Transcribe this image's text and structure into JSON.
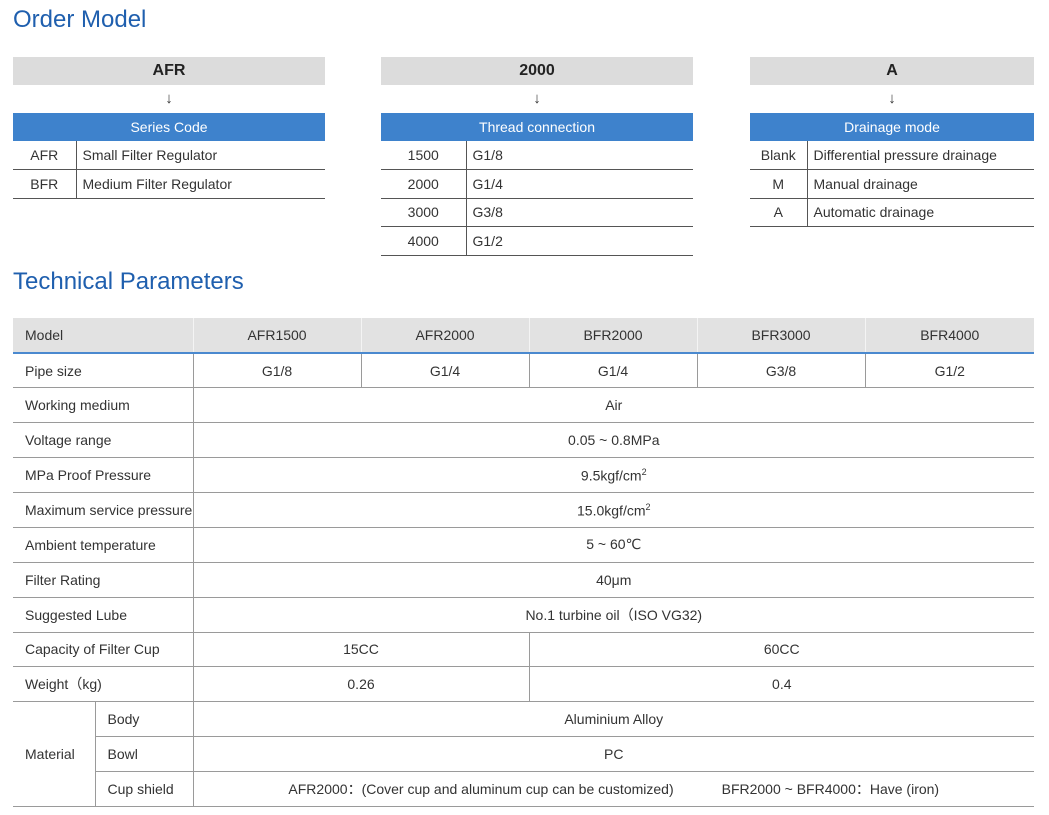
{
  "order_model": {
    "title": "Order Model",
    "arrow": "↓",
    "blocks": [
      {
        "code": "AFR",
        "heading": "Series Code",
        "rows": [
          {
            "code": "AFR",
            "desc": "Small Filter Regulator"
          },
          {
            "code": "BFR",
            "desc": "Medium Filter Regulator"
          }
        ]
      },
      {
        "code": "2000",
        "heading": "Thread connection",
        "rows": [
          {
            "code": "1500",
            "desc": "G1/8"
          },
          {
            "code": "2000",
            "desc": "G1/4"
          },
          {
            "code": "3000",
            "desc": "G3/8"
          },
          {
            "code": "4000",
            "desc": "G1/2"
          }
        ]
      },
      {
        "code": "A",
        "heading": "Drainage mode",
        "rows": [
          {
            "code": "Blank",
            "desc": "Differential pressure drainage"
          },
          {
            "code": "M",
            "desc": "Manual drainage"
          },
          {
            "code": "A",
            "desc": "Automatic drainage"
          }
        ]
      }
    ]
  },
  "technical": {
    "title": "Technical Parameters",
    "header": {
      "label": "Model",
      "models": [
        "AFR1500",
        "AFR2000",
        "BFR2000",
        "BFR3000",
        "BFR4000"
      ]
    },
    "pipe_size": {
      "label": "Pipe size",
      "values": [
        "G1/8",
        "G1/4",
        "G1/4",
        "G3/8",
        "G1/2"
      ]
    },
    "working_medium": {
      "label": "Working medium",
      "value": "Air"
    },
    "voltage_range": {
      "label": "Voltage range",
      "value": "0.05 ~ 0.8MPa"
    },
    "proof_pressure": {
      "label": "MPa Proof Pressure",
      "value": "9.5kgf/cm",
      "sup": "2"
    },
    "max_service": {
      "label": "Maximum service pressure",
      "value": "15.0kgf/cm",
      "sup": "2"
    },
    "ambient": {
      "label": "Ambient temperature",
      "value": "5 ~ 60℃"
    },
    "filter_rating": {
      "label": "Filter Rating",
      "value": "40μm"
    },
    "lube": {
      "label": "Suggested Lube",
      "value": "No.1 turbine oil（ISO VG32)"
    },
    "capacity": {
      "label": "Capacity of Filter Cup",
      "afr": "15CC",
      "bfr": "60CC"
    },
    "weight": {
      "label": "Weight（kg)",
      "afr": "0.26",
      "bfr": "0.4"
    },
    "material": {
      "label": "Material",
      "body_label": "Body",
      "body_value": "Aluminium Alloy",
      "bowl_label": "Bowl",
      "bowl_value": "PC",
      "shield_label": "Cup shield",
      "shield_afr": "AFR2000：(Cover cup and aluminum cup can be customized)",
      "shield_bfr": "BFR2000 ~ BFR4000：Have (iron)"
    }
  }
}
